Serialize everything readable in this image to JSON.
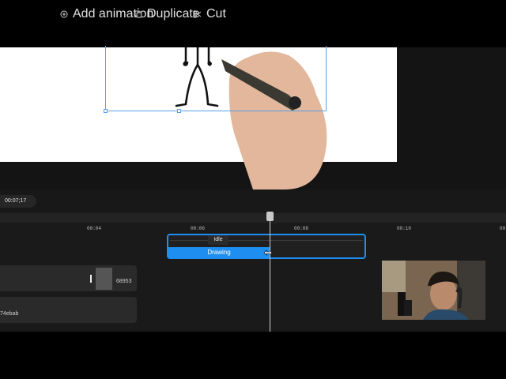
{
  "toolbar": {
    "timecode": "00:07;17",
    "add_animation": "Add animation",
    "duplicate": "Duplicate",
    "cut": "Cut"
  },
  "ruler": {
    "ticks": [
      "00:04",
      "00:06",
      "00:08",
      "00:10",
      "00"
    ]
  },
  "animation_track": {
    "idle_label": "Idle",
    "drawing_label": "Drawing"
  },
  "clips": {
    "clip1_label": "68953",
    "clip2_label": "74ebab"
  },
  "colors": {
    "accent": "#1e8ff0",
    "timeline_bg": "#1a1a1a",
    "clip_bg": "#2a2a2a"
  },
  "icons": [
    "add-animation-icon",
    "duplicate-icon",
    "scissors-icon",
    "resize-cursor-icon",
    "stick-figure",
    "hand-with-marker",
    "webcam-presenter"
  ]
}
